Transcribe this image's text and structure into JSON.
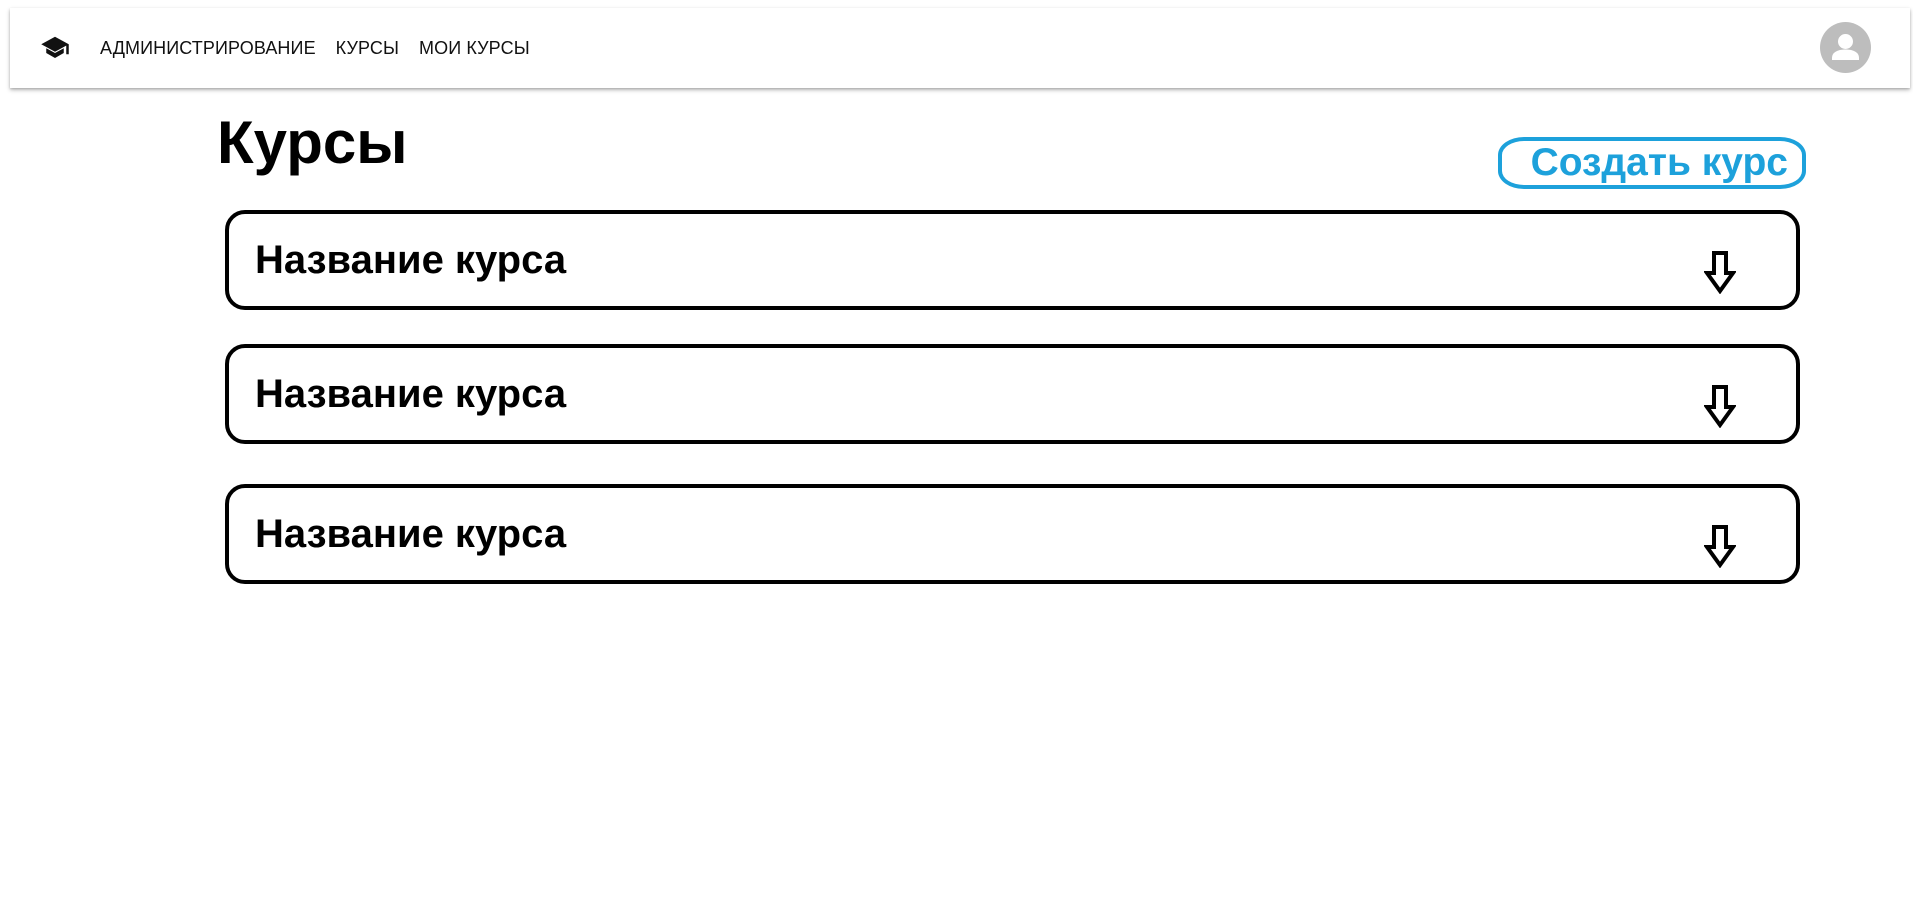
{
  "header": {
    "logo_icon": "graduation-cap-icon",
    "nav_items": [
      {
        "label": "АДМИНИСТРИРОВАНИЕ"
      },
      {
        "label": "КУРСЫ"
      },
      {
        "label": "МОИ КУРСЫ"
      }
    ],
    "avatar_icon": "user-avatar-icon"
  },
  "page": {
    "title": "Курсы",
    "create_button_label": "Создать курс"
  },
  "courses": [
    {
      "title": "Название курса",
      "icon": "arrow-down-icon"
    },
    {
      "title": "Название курса",
      "icon": "arrow-down-icon"
    },
    {
      "title": "Название курса",
      "icon": "arrow-down-icon"
    }
  ],
  "colors": {
    "accent": "#1da1db",
    "avatar_bg": "#bdbdbd",
    "card_border": "#000000"
  }
}
